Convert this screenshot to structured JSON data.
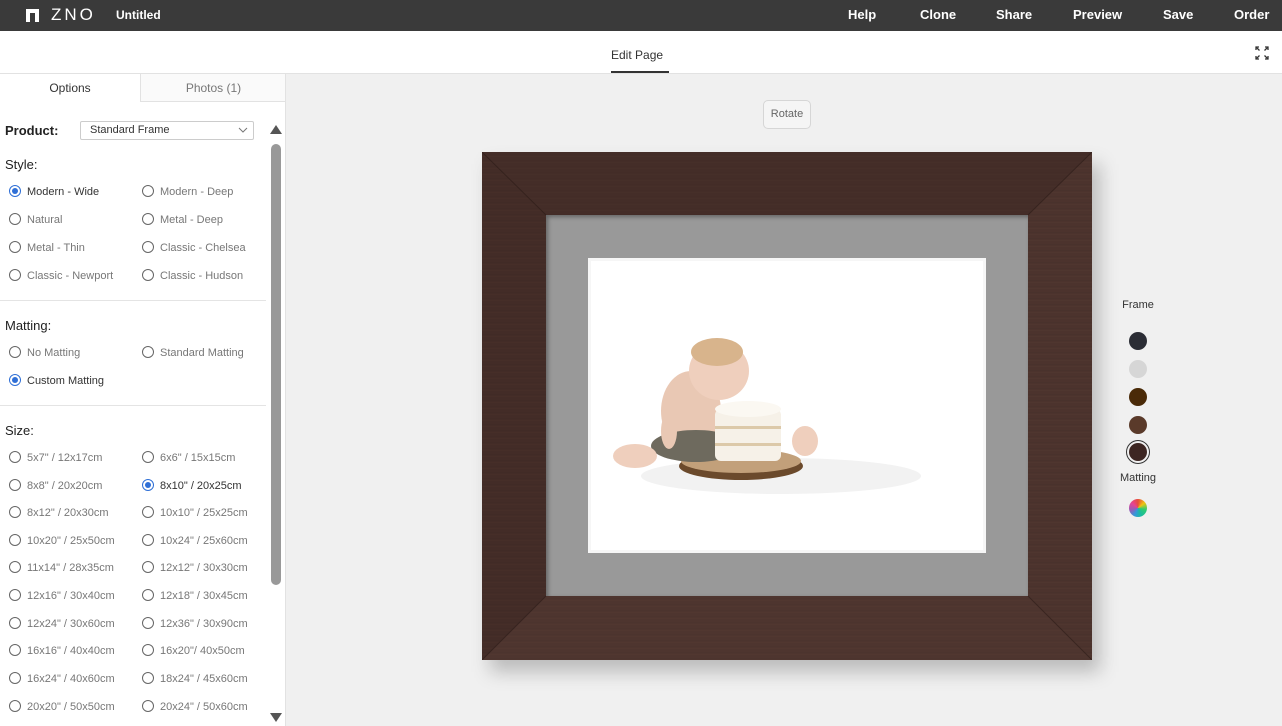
{
  "topbar": {
    "logo_text": "ZNO",
    "doc_title": "Untitled",
    "nav": [
      "Help",
      "Clone",
      "Share",
      "Preview",
      "Save",
      "Order"
    ]
  },
  "subheader": {
    "tab": "Edit Page"
  },
  "panel": {
    "tabs": [
      "Options",
      "Photos (1)"
    ],
    "product_label": "Product:",
    "product_value": "Standard Frame",
    "style_label": "Style:",
    "style_options": [
      "Modern - Wide",
      "Modern - Deep",
      "Natural",
      "Metal - Deep",
      "Metal - Thin",
      "Classic - Chelsea",
      "Classic - Newport",
      "Classic - Hudson"
    ],
    "style_selected": "Modern - Wide",
    "matting_label": "Matting:",
    "matting_options": [
      "No Matting",
      "Standard Matting",
      "Custom Matting"
    ],
    "matting_selected": "Custom Matting",
    "size_label": "Size:",
    "size_options": [
      "5x7\" / 12x17cm",
      "6x6\" / 15x15cm",
      "8x8\" / 20x20cm",
      "8x10\" / 20x25cm",
      "8x12\" / 20x30cm",
      "10x10\" / 25x25cm",
      "10x20\" / 25x50cm",
      "10x24\" / 25x60cm",
      "11x14\" / 28x35cm",
      "12x12\" / 30x30cm",
      "12x16\" / 30x40cm",
      "12x18\" / 30x45cm",
      "12x24\" / 30x60cm",
      "12x36\" / 30x90cm",
      "16x16\" / 40x40cm",
      "16x20\"/ 40x50cm",
      "16x24\" / 40x60cm",
      "18x24\" / 45x60cm",
      "20x20\" / 50x50cm",
      "20x24\" / 50x60cm"
    ],
    "size_selected": "8x10\" / 20x25cm"
  },
  "canvas": {
    "rotate_label": "Rotate"
  },
  "palette": {
    "frame_title": "Frame",
    "frame_colors": [
      "#2b2d35",
      "#d6d6d6",
      "#4a2a08",
      "#5a3a2a",
      "#3d2622"
    ],
    "frame_selected_index": 4,
    "matting_title": "Matting"
  },
  "colors": {
    "accent": "#2f6fd6",
    "topbar": "#3a3a3a",
    "frame_wood": "#4a322c",
    "mat": "#999999"
  }
}
